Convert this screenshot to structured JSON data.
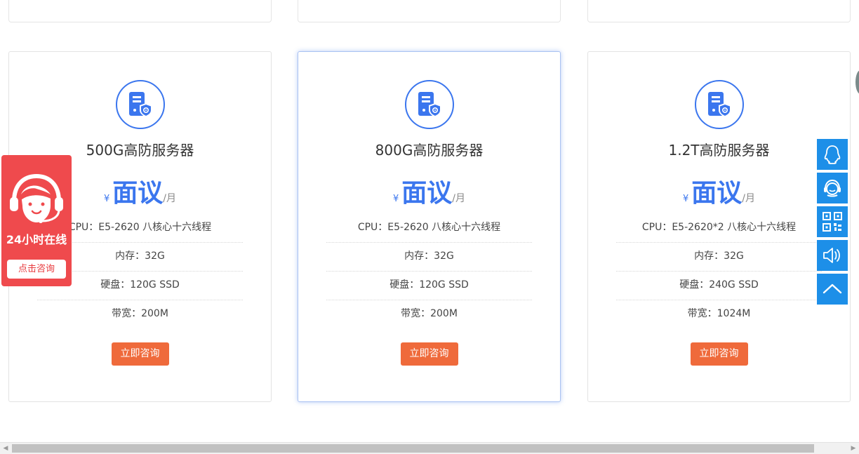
{
  "cards": [
    {
      "title": "500G高防服务器",
      "currency": "¥",
      "price": "面议",
      "unit": "/月",
      "specs": [
        "CPU：E5-2620 八核心十六线程",
        "内存：32G",
        "硬盘：120G SSD",
        "带宽：200M"
      ],
      "button": "立即咨询"
    },
    {
      "title": "800G高防服务器",
      "currency": "¥",
      "price": "面议",
      "unit": "/月",
      "specs": [
        "CPU：E5-2620 八核心十六线程",
        "内存：32G",
        "硬盘：120G SSD",
        "带宽：200M"
      ],
      "button": "立即咨询"
    },
    {
      "title": "1.2T高防服务器",
      "currency": "¥",
      "price": "面议",
      "unit": "/月",
      "specs": [
        "CPU：E5-2620*2 八核心十六线程",
        "内存：32G",
        "硬盘：240G SSD",
        "带宽：1024M"
      ],
      "button": "立即咨询"
    }
  ],
  "float_service": {
    "label": "24小时在线",
    "button": "点击咨询"
  },
  "side_tools": [
    "qq-icon",
    "customer-service-icon",
    "qr-code-icon",
    "speaker-icon",
    "back-to-top-icon"
  ],
  "colors": {
    "accent_blue": "#3b76ee",
    "button_orange": "#ef6a3b",
    "float_red": "#ef4a4d",
    "side_tool_blue": "#1d8fe8"
  }
}
